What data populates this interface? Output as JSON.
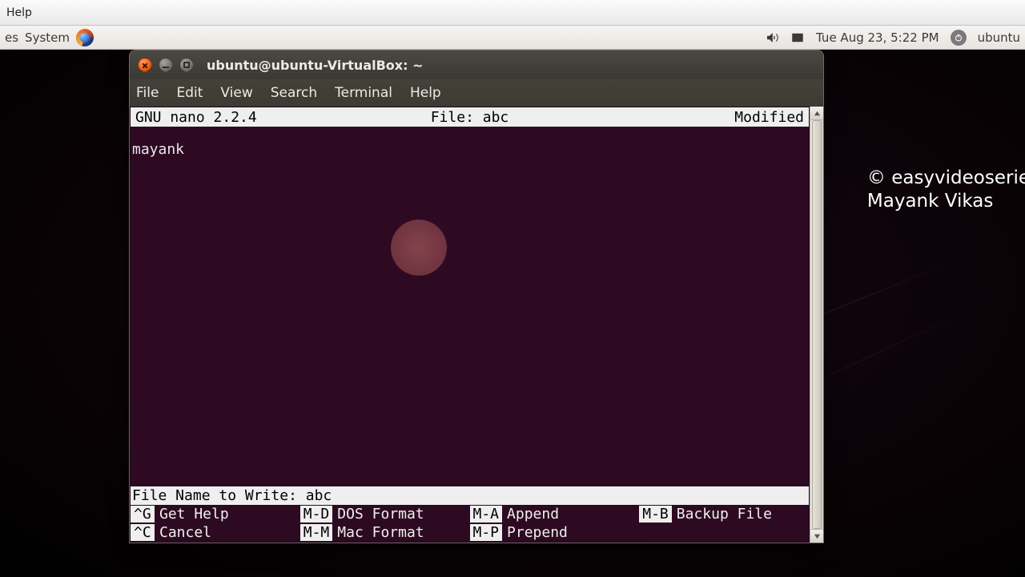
{
  "host": {
    "help_label": "Help"
  },
  "panel": {
    "left": {
      "item_trunc": "es",
      "system_label": "System"
    },
    "right": {
      "datetime": "Tue Aug 23,  5:22 PM",
      "username": "ubuntu"
    }
  },
  "watermark": {
    "line1": "© easyvideoserie",
    "line2": "Mayank Vikas"
  },
  "terminal": {
    "title": "ubuntu@ubuntu-VirtualBox: ~",
    "menu": {
      "file": "File",
      "edit": "Edit",
      "view": "View",
      "search": "Search",
      "terminal": "Terminal",
      "help": "Help"
    },
    "nano": {
      "app": "GNU nano 2.2.4",
      "file_label": "File: abc",
      "status": "Modified",
      "content": "mayank",
      "prompt": "File Name to Write: abc",
      "shortcuts": [
        {
          "key": "^G",
          "label": "Get Help"
        },
        {
          "key": "M-D",
          "label": "DOS Format"
        },
        {
          "key": "M-A",
          "label": "Append"
        },
        {
          "key": "M-B",
          "label": "Backup File"
        },
        {
          "key": "^C",
          "label": "Cancel"
        },
        {
          "key": "M-M",
          "label": "Mac Format"
        },
        {
          "key": "M-P",
          "label": "Prepend"
        },
        {
          "key": "",
          "label": ""
        }
      ]
    }
  }
}
